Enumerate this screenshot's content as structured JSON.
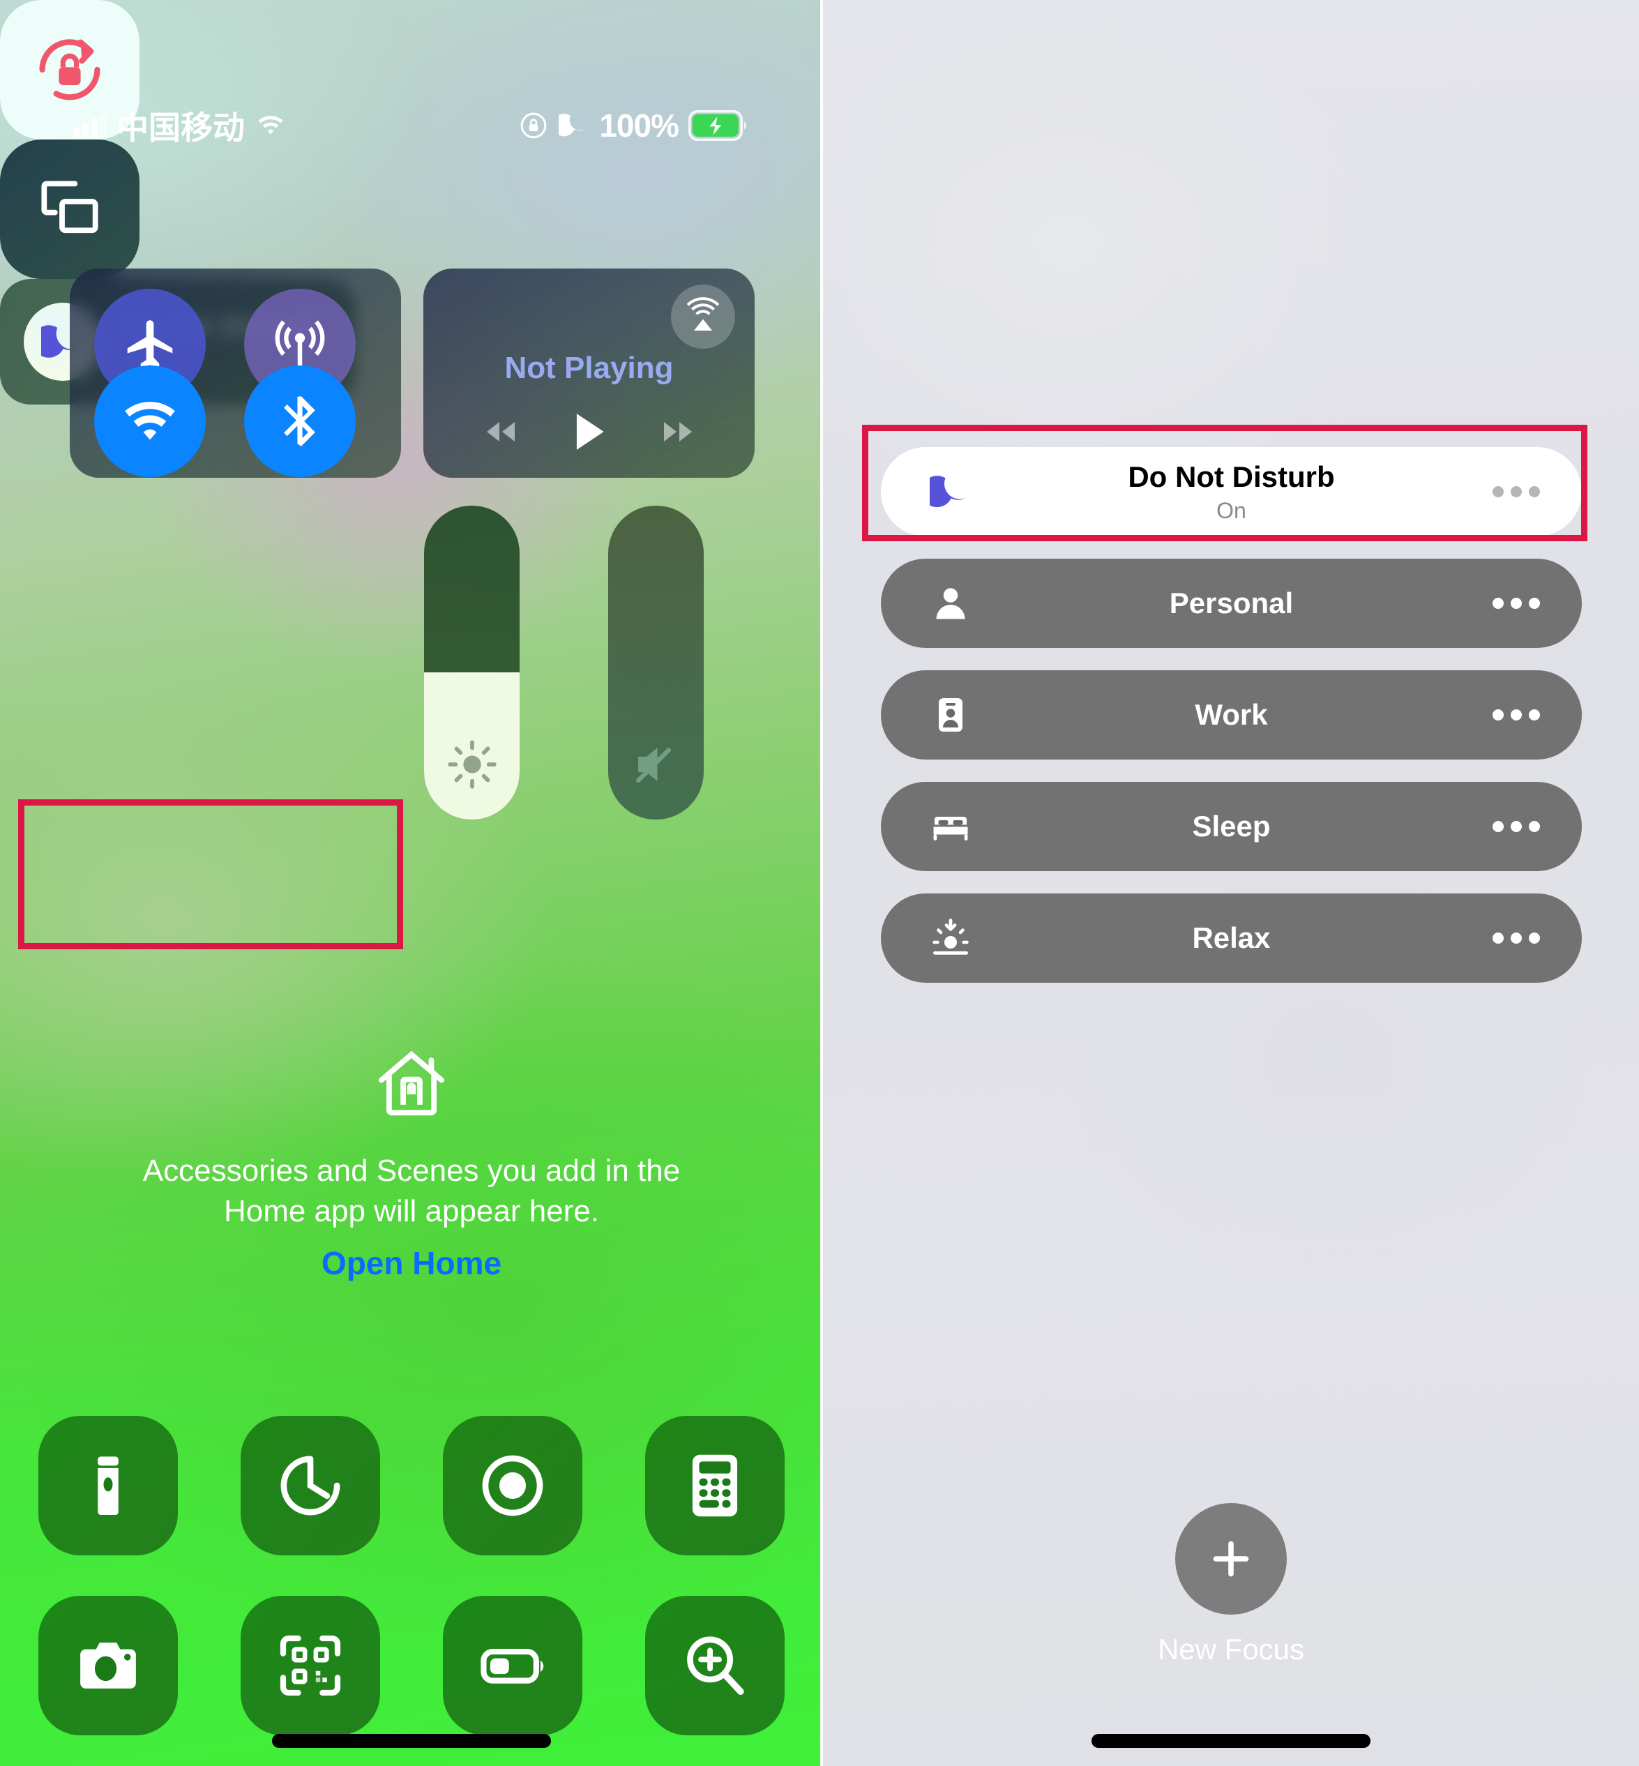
{
  "status_bar": {
    "carrier": "中国移动",
    "battery_percent": "100%",
    "icons": [
      "signal-bars-icon",
      "wifi-icon",
      "rotation-lock-icon",
      "moon-icon",
      "battery-charging-icon"
    ]
  },
  "control_center": {
    "connectivity": {
      "airplane_mode": {
        "name": "airplane-mode-toggle",
        "state": "off"
      },
      "cellular_data": {
        "name": "cellular-data-toggle",
        "state": "off"
      },
      "wifi": {
        "name": "wifi-toggle",
        "state": "on"
      },
      "bluetooth": {
        "name": "bluetooth-toggle",
        "state": "on"
      }
    },
    "media": {
      "status_label": "Not Playing",
      "airplay_icon": "airplay-audio-icon",
      "controls": [
        "rewind-button",
        "play-button",
        "fast-forward-button"
      ]
    },
    "rotation_lock": {
      "label": "Portrait Orientation Lock",
      "state": "on"
    },
    "screen_mirroring": {
      "label": "Screen Mirroring",
      "state": "off"
    },
    "focus_tile": {
      "title": "Do Not Disturb",
      "state": "On",
      "icon": "moon-icon"
    },
    "brightness": {
      "label": "Display Brightness",
      "percent": 47
    },
    "volume": {
      "label": "Volume",
      "percent": 0,
      "muted": true
    },
    "home": {
      "description": "Accessories and Scenes you add in the Home app will appear here.",
      "link": "Open Home",
      "icon": "house-icon"
    },
    "shortcuts": [
      {
        "name": "flashlight-button",
        "icon": "flashlight-icon"
      },
      {
        "name": "timer-button",
        "icon": "timer-icon"
      },
      {
        "name": "screen-record-button",
        "icon": "record-icon"
      },
      {
        "name": "calculator-button",
        "icon": "calculator-icon"
      },
      {
        "name": "camera-button",
        "icon": "camera-icon"
      },
      {
        "name": "code-scanner-button",
        "icon": "qr-scanner-icon"
      },
      {
        "name": "low-power-mode-button",
        "icon": "battery-icon"
      },
      {
        "name": "magnifier-button",
        "icon": "magnifier-icon"
      }
    ]
  },
  "focus_panel": {
    "modes": [
      {
        "label": "Do Not Disturb",
        "sub": "On",
        "icon": "moon-icon",
        "active": true
      },
      {
        "label": "Personal",
        "sub": "",
        "icon": "person-icon",
        "active": false
      },
      {
        "label": "Work",
        "sub": "",
        "icon": "id-badge-icon",
        "active": false
      },
      {
        "label": "Sleep",
        "sub": "",
        "icon": "bed-icon",
        "active": false
      },
      {
        "label": "Relax",
        "sub": "",
        "icon": "sunset-icon",
        "active": false
      }
    ],
    "new_focus": {
      "label": "New Focus",
      "icon": "plus-icon"
    }
  },
  "annotation": {
    "highlight_color": "#dc1745",
    "highlighted_elements": [
      "control-center-focus-tile",
      "focus-panel-do-not-disturb-pill"
    ]
  }
}
